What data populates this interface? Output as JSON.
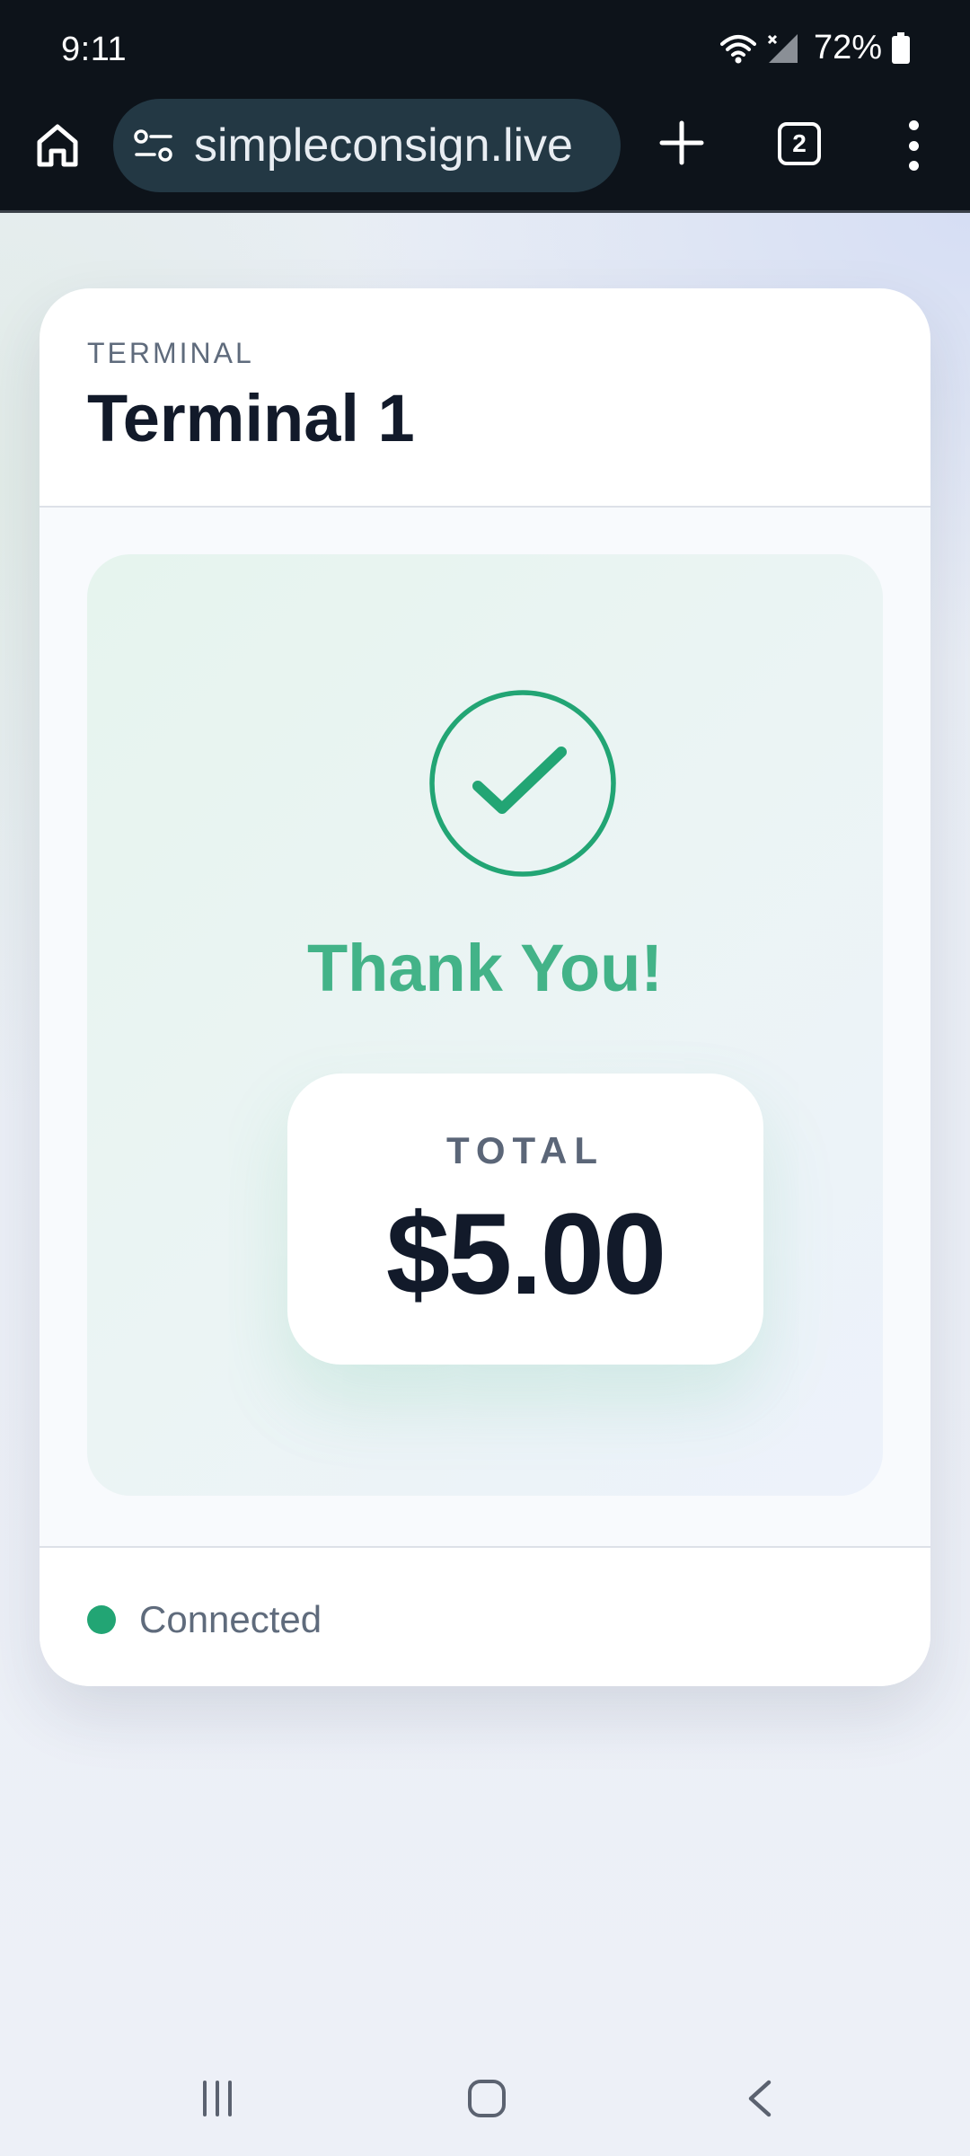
{
  "status_bar": {
    "time": "9:11",
    "battery_percent": "72%",
    "icons": [
      "wifi-icon",
      "signal-off-icon",
      "battery-icon"
    ]
  },
  "browser": {
    "url": "simpleconsign.live",
    "tab_count": "2",
    "icons": [
      "home-icon",
      "site-settings-icon",
      "plus-icon",
      "tabs-icon",
      "more-vert-icon"
    ]
  },
  "card": {
    "header_label": "TERMINAL",
    "header_title": "Terminal 1",
    "message": "Thank You!",
    "total_label": "TOTAL",
    "total_value": "$5.00",
    "connection_status": "Connected"
  },
  "colors": {
    "success_green": "#22a574",
    "thank_you_green": "#43b388",
    "dark_text": "#121a2a",
    "muted_text": "#5f6b7c",
    "system_bar": "#0d131a",
    "url_pill": "#233844"
  },
  "nav_bar": {
    "icons": [
      "recents-icon",
      "home-circle-icon",
      "back-icon"
    ]
  }
}
